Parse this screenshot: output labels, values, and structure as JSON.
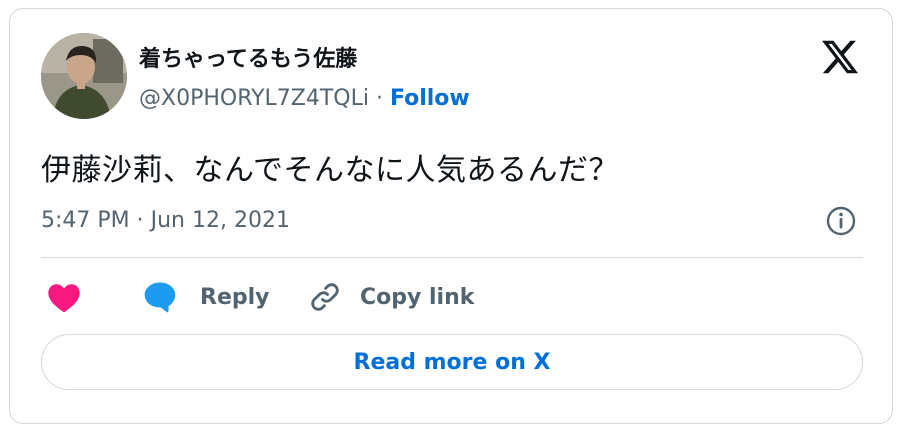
{
  "author": {
    "display_name": "着ちゃってるもう佐藤",
    "handle": "@X0PHORYL7Z4TQLi",
    "separator": " · ",
    "follow_label": "Follow"
  },
  "tweet": {
    "text": "伊藤沙莉、なんでそんなに人気あるんだ？",
    "timestamp": "5:47 PM · Jun 12, 2021"
  },
  "actions": {
    "reply_label": "Reply",
    "copy_link_label": "Copy link"
  },
  "read_more_label": "Read more on X",
  "icons": {
    "brand": "x-logo-icon",
    "info": "info-icon",
    "like": "heart-icon",
    "reply": "speech-bubble-icon",
    "copy": "link-icon"
  },
  "colors": {
    "accent": "#006fd6",
    "heart": "#f91880",
    "reply_bubble": "#1d9bf0",
    "muted": "#536471",
    "border": "#cfd9de"
  }
}
